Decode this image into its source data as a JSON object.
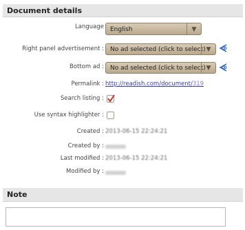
{
  "sections": {
    "document_details": "Document details",
    "note": "Note"
  },
  "fields": {
    "language": {
      "label": "Language",
      "value": "English"
    },
    "right_ad": {
      "label": "Right panel advertisement :",
      "value": "No ad selected (click to select)"
    },
    "bottom_ad": {
      "label": "Bottom ad :",
      "value": "No ad selected (click to select)"
    },
    "permalink": {
      "label": "Permalink :",
      "url_prefix": "http://readish.com/document/",
      "url_id": "319"
    },
    "search_listing": {
      "label": "Search listing :",
      "checked": true
    },
    "syntax_highlighter": {
      "label": "Use syntax highlighter :",
      "checked": false
    },
    "created": {
      "label": "Created :",
      "value": "2013-06-15 22:24:21"
    },
    "created_by": {
      "label": "Created by :"
    },
    "last_modified": {
      "label": "Last modified :",
      "value": "2013-06-15 22:24:21"
    },
    "modified_by": {
      "label": "Modified by :"
    }
  },
  "colors": {
    "header_bg": "#e6e6e6",
    "select_bg": "#c9bba1",
    "link": "#3a3fb0",
    "check_mark": "#c0392b",
    "ad_icon": "#2a63b8"
  },
  "icons": {
    "dropdown": "chevron-down-icon",
    "ad_info": "eye-arrow-icon",
    "check": "checkmark-icon"
  },
  "note": {
    "value": ""
  }
}
